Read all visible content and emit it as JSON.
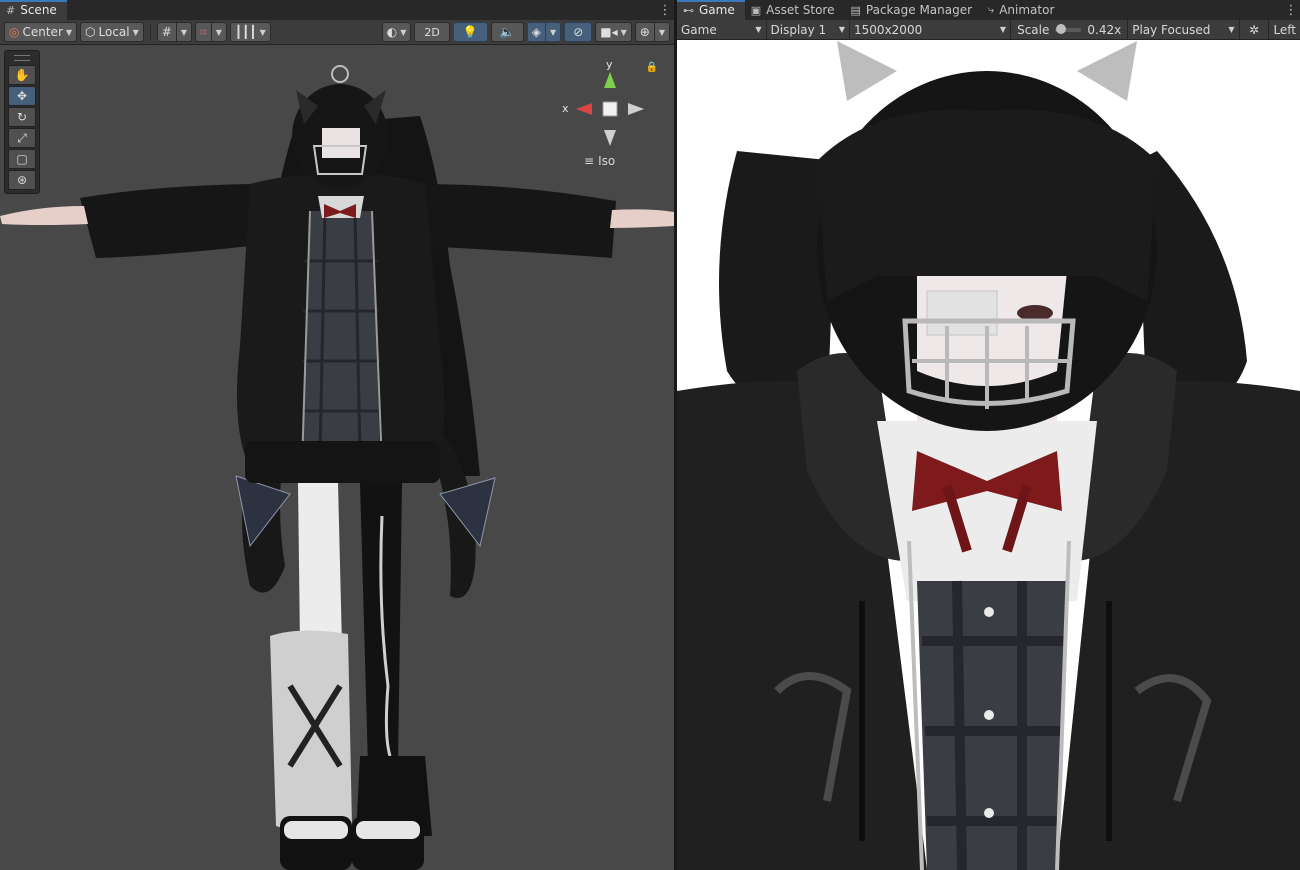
{
  "scene": {
    "tab_label": "Scene",
    "toolbar": {
      "pivot": "Center",
      "space": "Local",
      "mode_2d": "2D"
    },
    "gizmo": {
      "x_label": "x",
      "y_label": "y",
      "projection": "Iso"
    }
  },
  "tabs": {
    "game": "Game",
    "asset_store": "Asset Store",
    "package_manager": "Package Manager",
    "animator": "Animator"
  },
  "game": {
    "toolbar": {
      "view": "Game",
      "display": "Display 1",
      "resolution": "1500x2000",
      "scale_label": "Scale",
      "scale_value": "0.42x",
      "play_mode": "Play Focused",
      "trailing": "Left"
    },
    "scale_slider_fraction": 0.05
  },
  "colors": {
    "accent": "#3a79bb",
    "active_tool": "#46607c",
    "gizmo_x": "#d94545",
    "gizmo_y": "#7fd04a"
  }
}
